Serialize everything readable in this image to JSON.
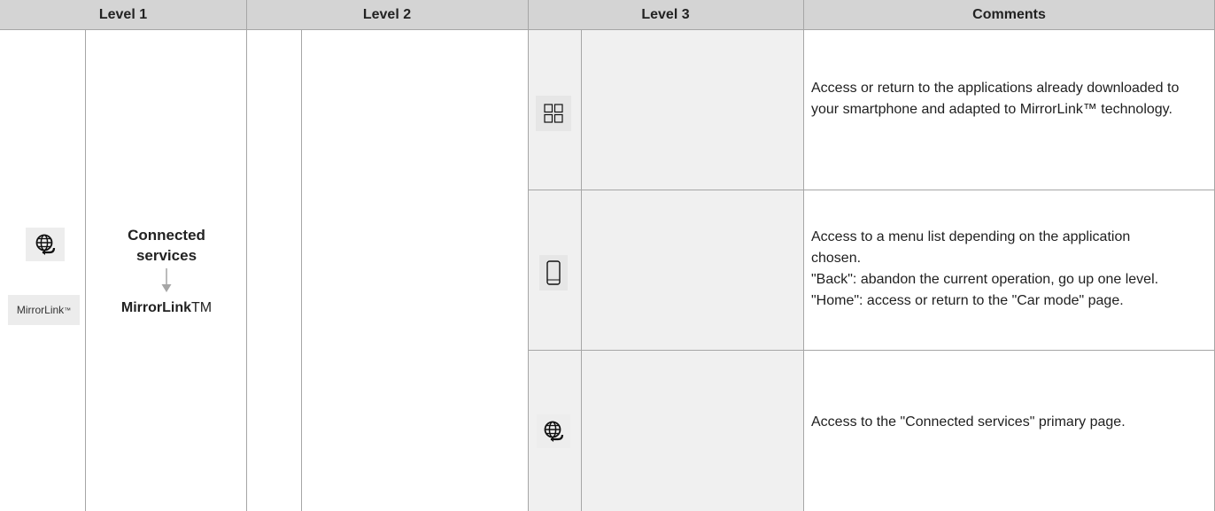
{
  "header": {
    "level1": "Level 1",
    "level2": "Level 2",
    "level3": "Level 3",
    "comments": "Comments"
  },
  "level1": {
    "title": "Connected services",
    "submenu": "MirrorLink",
    "submenu_tm": "TM",
    "logo_text": "MirrorLink",
    "logo_tm": "™",
    "icon": "connected-services-icon"
  },
  "rows": [
    {
      "icon": "apps-grid-icon",
      "comment": "Access or return to the applications already downloaded to your smartphone and adapted to MirrorLink™ technology."
    },
    {
      "icon": "smartphone-icon",
      "comment_lines": [
        "Access to a menu list depending on the application chosen.",
        "\"Back\": abandon the current operation, go up one level.",
        "\"Home\": access or return to the \"Car mode\" page."
      ]
    },
    {
      "icon": "connected-services-icon",
      "comment": "Access to the \"Connected services\" primary page."
    }
  ],
  "colors": {
    "header_bg": "#d4d4d4",
    "level3_bg": "#f0f0f0",
    "border": "#a6a6a6",
    "arrow": "#a6a6a6"
  }
}
